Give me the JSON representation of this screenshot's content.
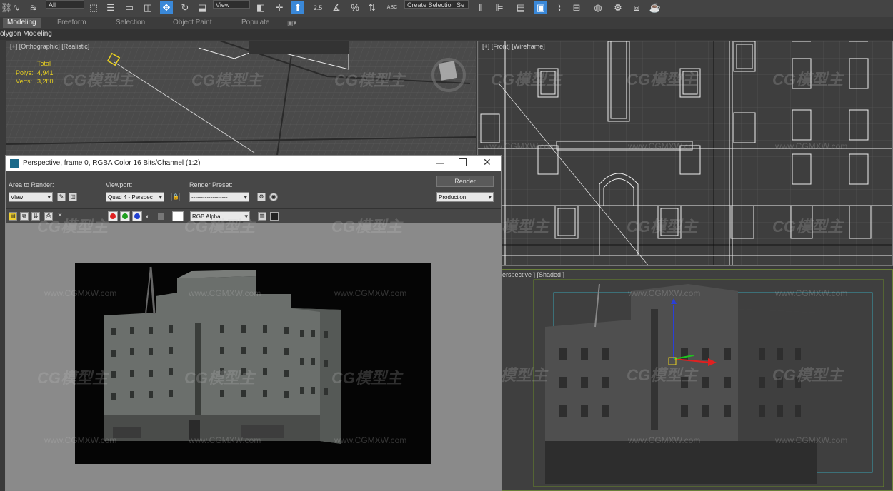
{
  "toolbar": {
    "selection_filter": "All",
    "reference_coord": "View",
    "named_selection_placeholder": "Create Selection Se",
    "snap_angle_label": "2.5",
    "percent_snap_label": "%",
    "spinner_snap_label": "ABC"
  },
  "ribbon": {
    "tabs": [
      "Modeling",
      "Freeform",
      "Selection",
      "Object Paint",
      "Populate"
    ],
    "active_tab": "Modeling",
    "sub_label": "olygon Modeling"
  },
  "viewport_top_left": {
    "label": "[+] [Orthographic] [Realistic]",
    "stats": {
      "total_label": "Total",
      "polys_label": "Polys:",
      "polys_value": "4,941",
      "verts_label": "Verts:",
      "verts_value": "3,280"
    }
  },
  "viewport_front": {
    "label": "[+] [Front] [Wireframe]"
  },
  "viewport_perspective": {
    "label": "erspective ] [Shaded ]"
  },
  "render_window": {
    "title": "Perspective, frame 0, RGBA Color 16 Bits/Channel (1:2)",
    "area_to_render_label": "Area to Render:",
    "area_to_render_value": "View",
    "viewport_label": "Viewport:",
    "viewport_value": "Quad 4 - Perspec",
    "render_preset_label": "Render Preset:",
    "render_preset_value": "-------------------",
    "render_button": "Render",
    "production_value": "Production",
    "channel_value": "RGB Alpha"
  },
  "watermarks": {
    "brand": "CG模型主",
    "url": "www.CGMXW.com"
  },
  "colors": {
    "accent_blue": "#3a88d8",
    "red_channel": "#e02020",
    "green_channel": "#20a020",
    "blue_channel": "#2040d0",
    "selection_yellow": "#e8d020"
  }
}
